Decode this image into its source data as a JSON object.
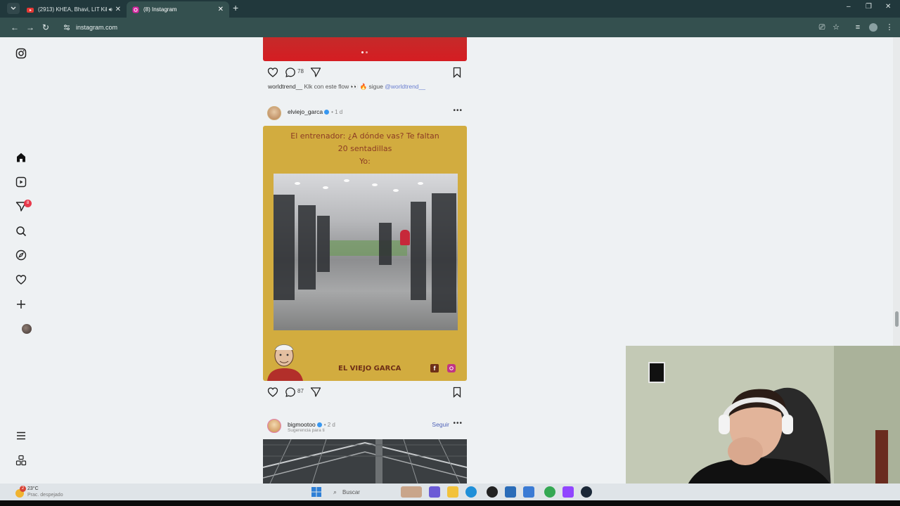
{
  "browser": {
    "tabs": [
      {
        "label": "(2913) KHEA, Bhavi, LIT Kill",
        "icon": "youtube-icon",
        "favicon_color": "#e53935"
      },
      {
        "label": "(8) Instagram",
        "icon": "instagram-icon",
        "favicon_color": "#d6249f",
        "active": true
      }
    ],
    "new_tab": "+",
    "url": "instagram.com",
    "window_controls": [
      "–",
      "❐",
      "✕"
    ]
  },
  "sidebar": {
    "items": [
      {
        "name": "home",
        "icon": "home-icon"
      },
      {
        "name": "reels",
        "icon": "reels-icon"
      },
      {
        "name": "messages",
        "icon": "messages-icon",
        "badge": "8"
      },
      {
        "name": "search",
        "icon": "search-icon"
      },
      {
        "name": "explore",
        "icon": "explore-icon"
      },
      {
        "name": "notifications",
        "icon": "heart-icon"
      },
      {
        "name": "create",
        "icon": "plus-icon"
      },
      {
        "name": "profile",
        "icon": "avatar"
      },
      {
        "name": "more",
        "icon": "menu-icon"
      },
      {
        "name": "threads",
        "icon": "apps-icon"
      }
    ]
  },
  "feed": {
    "post1": {
      "comment_count": "78",
      "caption_user": "worldtrend__",
      "caption_text": " Klk con este flow 👀 🔥 sigue ",
      "caption_mention": "@worldtrend__"
    },
    "post2": {
      "username": "elviejo_garca",
      "time": "• 1 d",
      "meme_line1": "El entrenador: ¿A dónde vas? Te faltan",
      "meme_line2": "20 sentadillas",
      "meme_line3": "Yo:",
      "brand": "EL VIEJO GARCA",
      "comment_count": "87"
    },
    "post3": {
      "username": "bigmootoo",
      "time": "• 2 d",
      "subtitle": "Sugerencia para ti",
      "follow_label": "Seguir"
    }
  },
  "taskbar": {
    "weather_temp": "23°C",
    "weather_desc": "Prac. despejado",
    "weather_badge": "2",
    "search_placeholder": "Buscar"
  },
  "colors": {
    "chrome_dark": "#21383c",
    "chrome_toolbar": "#34504f",
    "meme_bg": "#d2ac3f",
    "link_blue": "#4f63b8",
    "badge_red": "#e8394b"
  }
}
